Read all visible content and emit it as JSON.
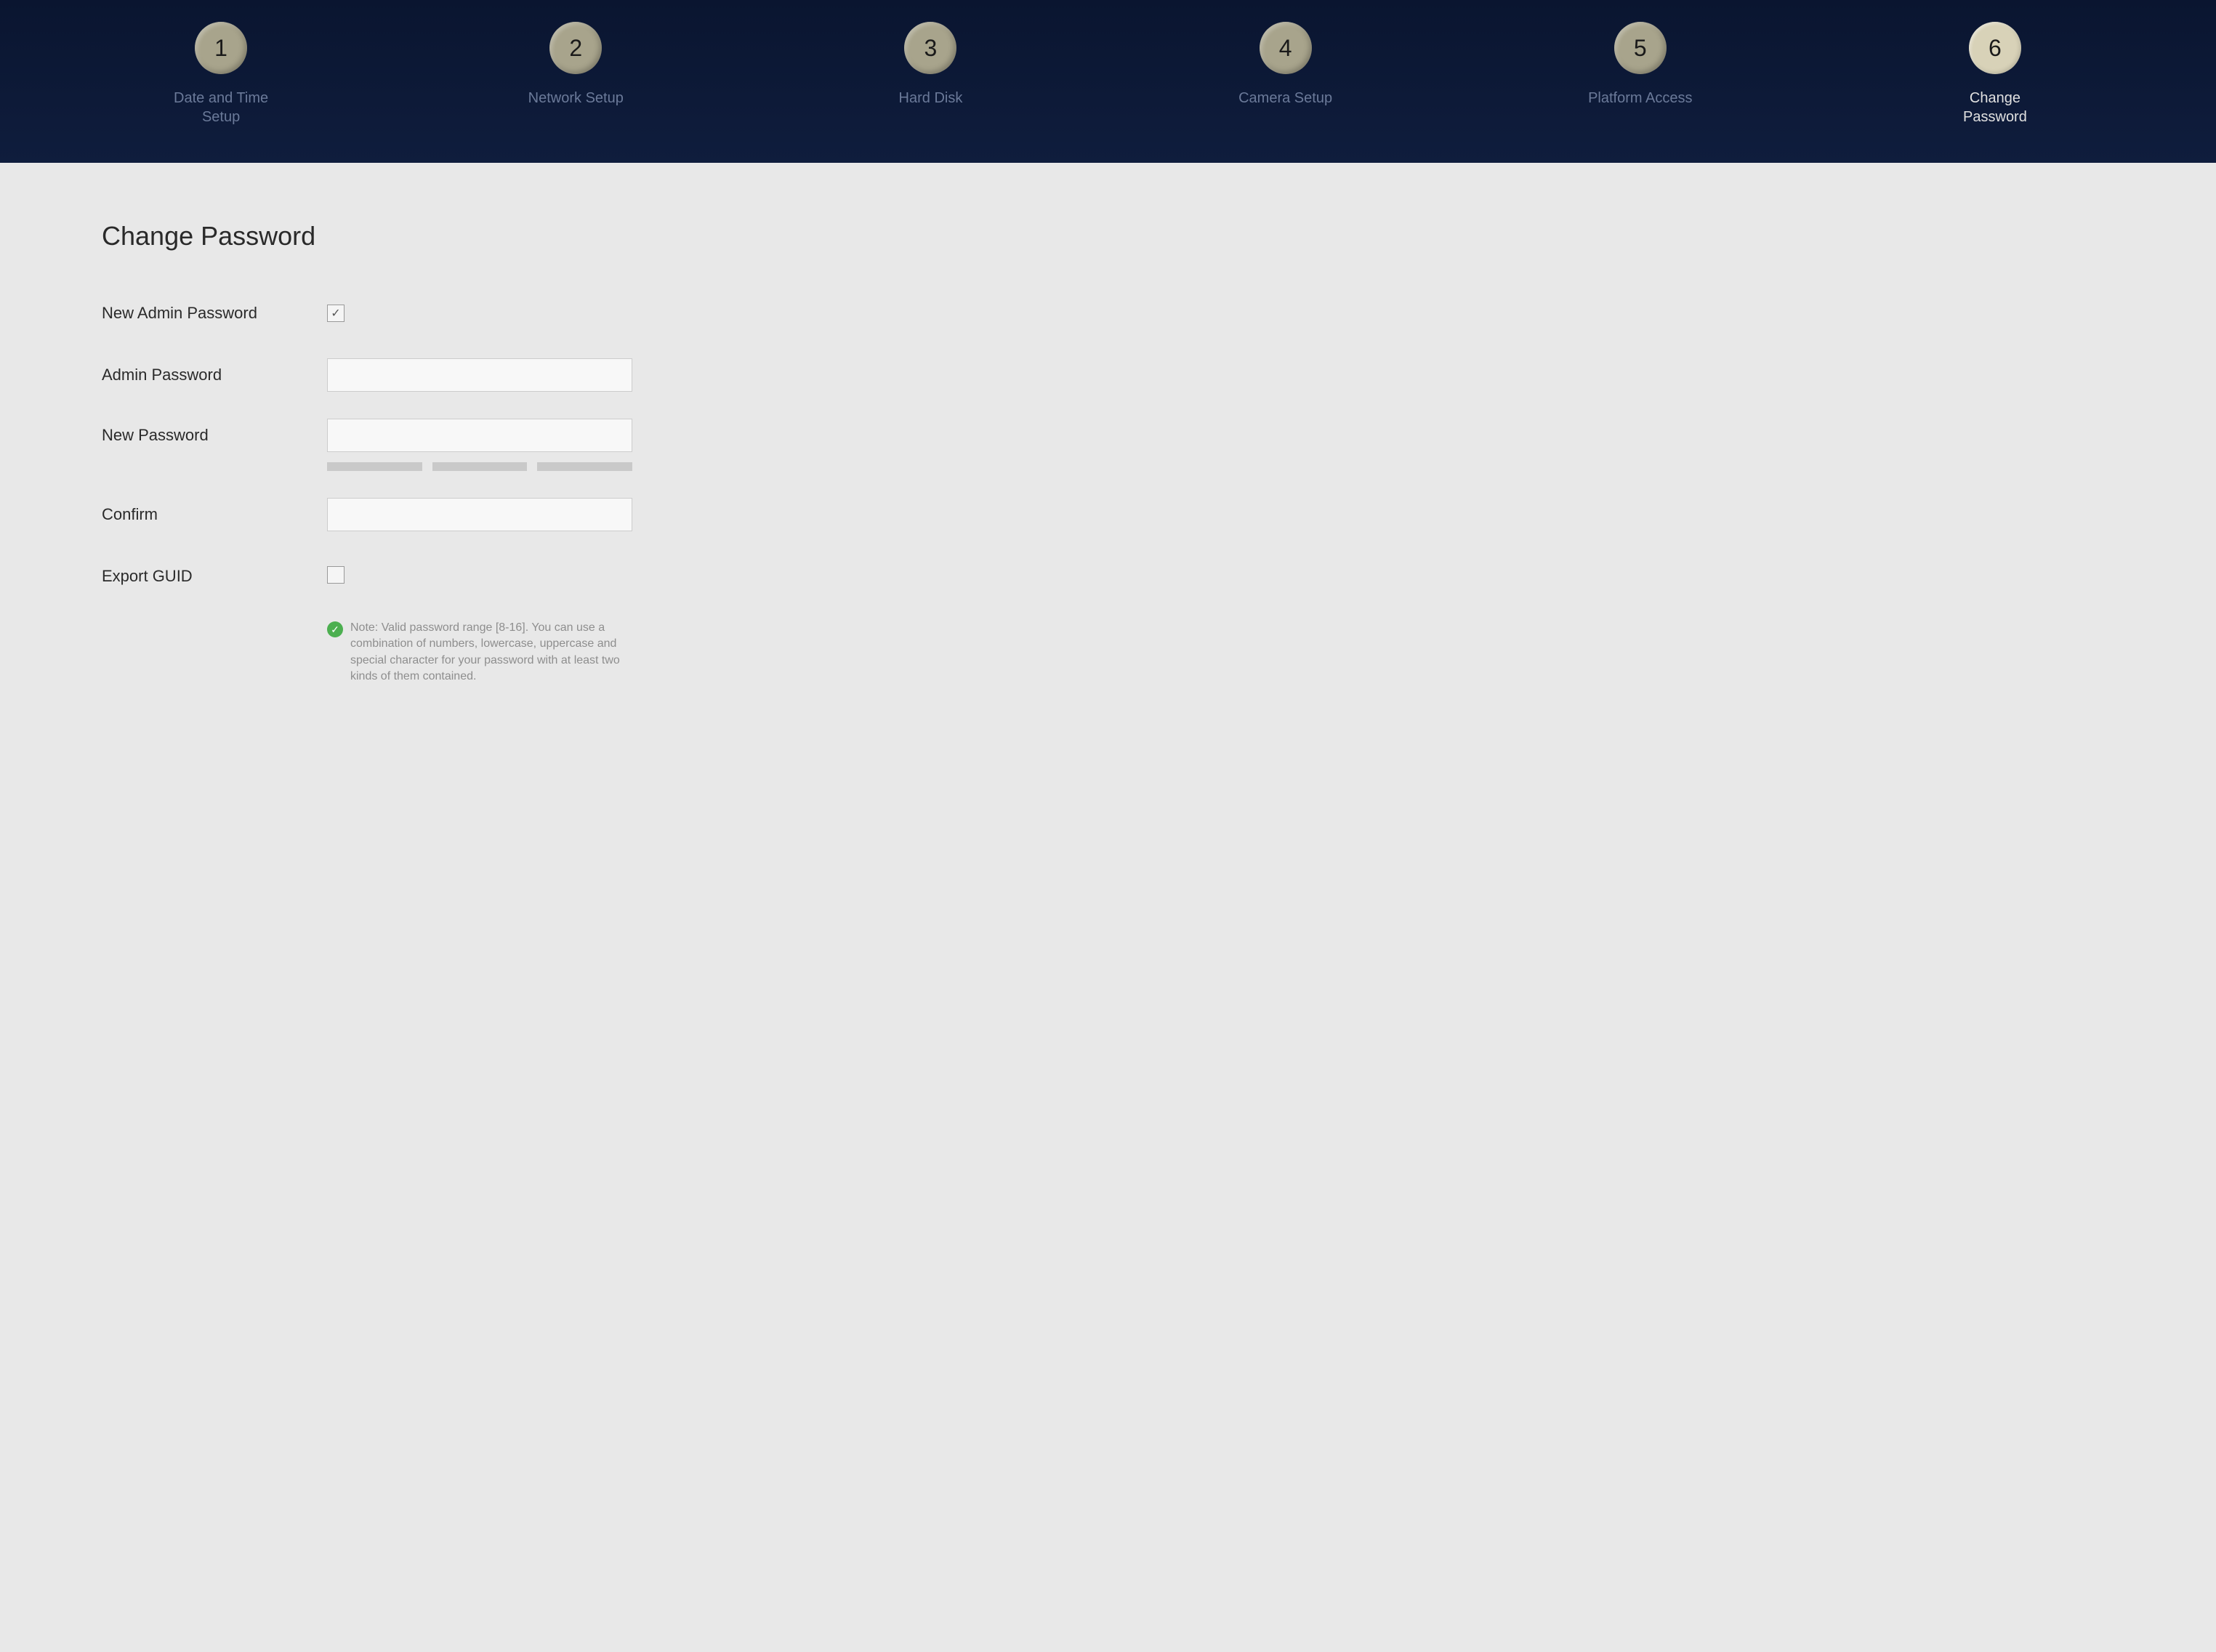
{
  "wizard": {
    "steps": [
      {
        "num": "1",
        "label": "Date and Time Setup",
        "active": false
      },
      {
        "num": "2",
        "label": "Network Setup",
        "active": false
      },
      {
        "num": "3",
        "label": "Hard Disk",
        "active": false
      },
      {
        "num": "4",
        "label": "Camera Setup",
        "active": false
      },
      {
        "num": "5",
        "label": "Platform Access",
        "active": false
      },
      {
        "num": "6",
        "label": "Change Password",
        "active": true
      }
    ]
  },
  "page": {
    "title": "Change Password"
  },
  "form": {
    "new_admin_password_label": "New Admin Password",
    "new_admin_password_checked": true,
    "admin_password_label": "Admin Password",
    "admin_password_value": "",
    "new_password_label": "New Password",
    "new_password_value": "",
    "confirm_label": "Confirm",
    "confirm_value": "",
    "export_guid_label": "Export GUID",
    "export_guid_checked": false,
    "note_text": "Note: Valid password range [8-16]. You can use a combination of numbers, lowercase, uppercase and special character for your password with at least two kinds of them contained."
  }
}
